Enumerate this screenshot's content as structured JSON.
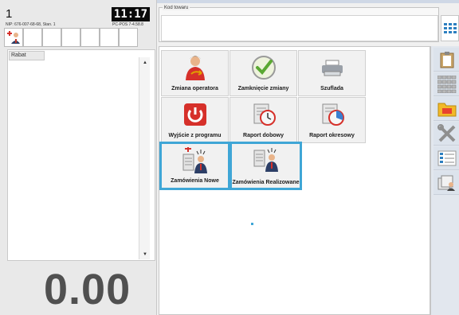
{
  "header": {
    "register_number": "1",
    "clock": "11:17",
    "nip_line": "NIP: 676-007-68-68, Stan. 1",
    "version": "PC-POS 7-4.58.8"
  },
  "receipt": {
    "rabat_label": "Rabat",
    "total": "0.00"
  },
  "product_code": {
    "label": "Kod towaru",
    "value": ""
  },
  "tiles": [
    {
      "label": "Zmiana operatora",
      "icon": "operator-change-icon"
    },
    {
      "label": "Zamknięcie zmiany",
      "icon": "close-shift-check-icon"
    },
    {
      "label": "Szuflada",
      "icon": "cash-drawer-printer-icon"
    },
    {
      "label": "Wyjście z programu",
      "icon": "power-exit-icon"
    },
    {
      "label": "Raport dobowy",
      "icon": "daily-report-clock-icon"
    },
    {
      "label": "Raport okresowy",
      "icon": "period-report-clock-icon"
    },
    {
      "label": "Zamówienia Nowe",
      "icon": "new-orders-icon"
    },
    {
      "label": "Zamówienia Realizowane",
      "icon": "orders-in-progress-icon"
    }
  ],
  "sidebar": [
    {
      "icon": "clipboard-icon"
    },
    {
      "icon": "calculator-grid-icon"
    },
    {
      "icon": "folder-icon"
    },
    {
      "icon": "tools-icon"
    },
    {
      "icon": "price-list-icon"
    },
    {
      "icon": "users-cards-icon"
    }
  ],
  "colors": {
    "selection_border": "#3fa6d6",
    "clock_bg": "#0a0a0a",
    "exit_red": "#d6302a"
  }
}
